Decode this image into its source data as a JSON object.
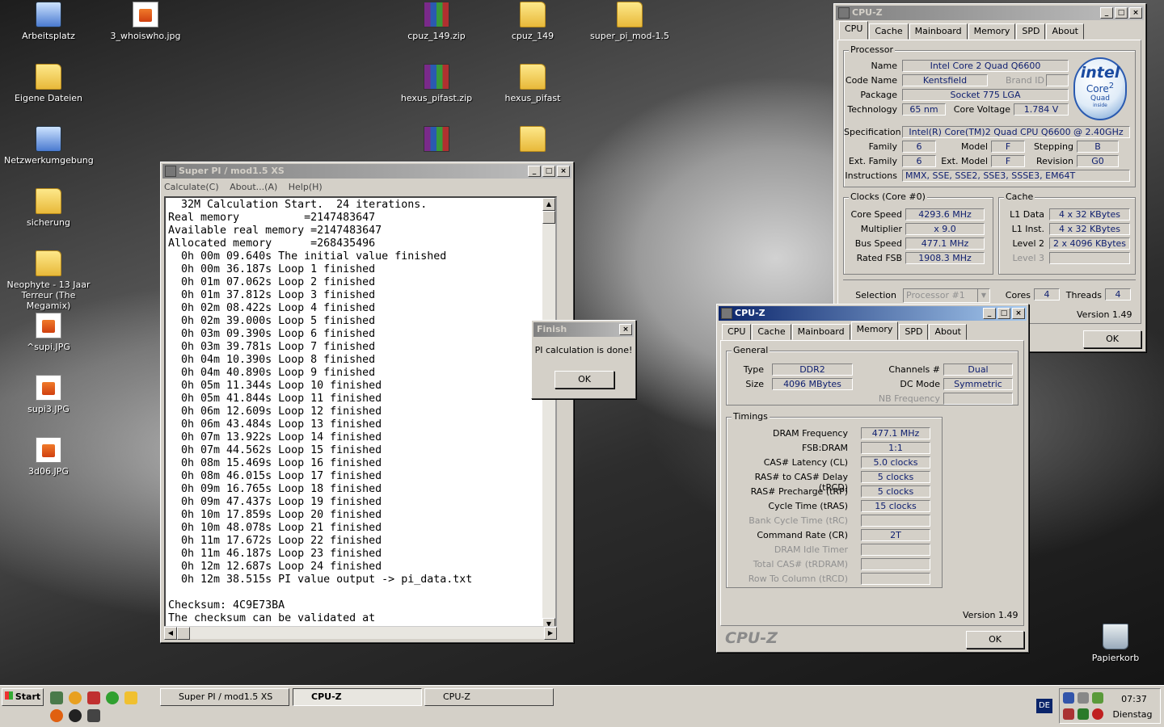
{
  "desktop": {
    "icons": [
      {
        "label": "Arbeitsplatz",
        "kind": "pc"
      },
      {
        "label": "3_whoiswho.jpg",
        "kind": "img"
      },
      {
        "label": "cpuz_149.zip",
        "kind": "zip"
      },
      {
        "label": "cpuz_149",
        "kind": "folder"
      },
      {
        "label": "super_pi_mod-1.5",
        "kind": "folder"
      },
      {
        "label": "Eigene Dateien",
        "kind": "folder"
      },
      {
        "label": "hexus_pifast.zip",
        "kind": "zip"
      },
      {
        "label": "hexus_pifast",
        "kind": "folder"
      },
      {
        "label": "Netzwerkumgebung",
        "kind": "pc"
      },
      {
        "label": "sicherung",
        "kind": "folder"
      },
      {
        "label": "Neophyte - 13 Jaar Terreur (The Megamix)",
        "kind": "folder"
      },
      {
        "label": "^supi.JPG",
        "kind": "img"
      },
      {
        "label": "supi3.JPG",
        "kind": "img"
      },
      {
        "label": "3d06.JPG",
        "kind": "img"
      },
      {
        "label": "Papierkorb",
        "kind": "trash"
      }
    ]
  },
  "superpi": {
    "title": "Super PI / mod1.5 XS",
    "menu": [
      "Calculate(C)",
      "About...(A)",
      "Help(H)"
    ],
    "output": "  32M Calculation Start.  24 iterations.\nReal memory          =2147483647\nAvailable real memory =2147483647\nAllocated memory      =268435496\n  0h 00m 09.640s The initial value finished\n  0h 00m 36.187s Loop 1 finished\n  0h 01m 07.062s Loop 2 finished\n  0h 01m 37.812s Loop 3 finished\n  0h 02m 08.422s Loop 4 finished\n  0h 02m 39.000s Loop 5 finished\n  0h 03m 09.390s Loop 6 finished\n  0h 03m 39.781s Loop 7 finished\n  0h 04m 10.390s Loop 8 finished\n  0h 04m 40.890s Loop 9 finished\n  0h 05m 11.344s Loop 10 finished\n  0h 05m 41.844s Loop 11 finished\n  0h 06m 12.609s Loop 12 finished\n  0h 06m 43.484s Loop 13 finished\n  0h 07m 13.922s Loop 14 finished\n  0h 07m 44.562s Loop 15 finished\n  0h 08m 15.469s Loop 16 finished\n  0h 08m 46.015s Loop 17 finished\n  0h 09m 16.765s Loop 18 finished\n  0h 09m 47.437s Loop 19 finished\n  0h 10m 17.859s Loop 20 finished\n  0h 10m 48.078s Loop 21 finished\n  0h 11m 17.672s Loop 22 finished\n  0h 11m 46.187s Loop 23 finished\n  0h 12m 12.687s Loop 24 finished\n  0h 12m 38.515s PI value output -> pi_data.txt\n\nChecksum: 4C9E73BA\nThe checksum can be validated at"
  },
  "finish": {
    "title": "Finish",
    "message": "PI calculation is done!",
    "ok": "OK"
  },
  "cpuz1": {
    "title": "CPU-Z",
    "tabs": [
      "CPU",
      "Cache",
      "Mainboard",
      "Memory",
      "SPD",
      "About"
    ],
    "processor": {
      "group": "Processor",
      "name_l": "Name",
      "name": "Intel Core 2 Quad Q6600",
      "code_l": "Code Name",
      "code": "Kentsfield",
      "brand_l": "Brand ID",
      "package_l": "Package",
      "package": "Socket 775 LGA",
      "tech_l": "Technology",
      "tech": "65 nm",
      "volt_l": "Core Voltage",
      "volt": "1.784 V",
      "spec_l": "Specification",
      "spec": "Intel(R) Core(TM)2 Quad CPU    Q6600  @ 2.40GHz",
      "family_l": "Family",
      "family": "6",
      "model_l": "Model",
      "model": "F",
      "stepping_l": "Stepping",
      "stepping": "B",
      "extfam_l": "Ext. Family",
      "extfam": "6",
      "extmod_l": "Ext. Model",
      "extmod": "F",
      "rev_l": "Revision",
      "rev": "G0",
      "instr_l": "Instructions",
      "instr": "MMX, SSE, SSE2, SSE3, SSSE3, EM64T"
    },
    "logo": {
      "brand": "intel",
      "line1": "Core",
      "line2": "2",
      "line3": "Quad",
      "line4": "inside"
    },
    "clocks": {
      "group": "Clocks (Core #0)",
      "speed_l": "Core Speed",
      "speed": "4293.6 MHz",
      "mult_l": "Multiplier",
      "mult": "x 9.0",
      "bus_l": "Bus Speed",
      "bus": "477.1 MHz",
      "fsb_l": "Rated FSB",
      "fsb": "1908.3 MHz"
    },
    "cache": {
      "group": "Cache",
      "l1d_l": "L1 Data",
      "l1d": "4 x 32 KBytes",
      "l1i_l": "L1 Inst.",
      "l1i": "4 x 32 KBytes",
      "l2_l": "Level 2",
      "l2": "2 x 4096 KBytes",
      "l3_l": "Level 3"
    },
    "sel_l": "Selection",
    "sel": "Processor #1",
    "cores_l": "Cores",
    "cores": "4",
    "threads_l": "Threads",
    "threads": "4",
    "version": "Version 1.49",
    "ok": "OK"
  },
  "cpuz2": {
    "title": "CPU-Z",
    "tabs": [
      "CPU",
      "Cache",
      "Mainboard",
      "Memory",
      "SPD",
      "About"
    ],
    "general": {
      "group": "General",
      "type_l": "Type",
      "type": "DDR2",
      "size_l": "Size",
      "size": "4096 MBytes",
      "ch_l": "Channels #",
      "ch": "Dual",
      "dc_l": "DC Mode",
      "dc": "Symmetric",
      "nb_l": "NB Frequency"
    },
    "timings": {
      "group": "Timings",
      "rows": [
        {
          "label": "DRAM Frequency",
          "value": "477.1 MHz",
          "dim": false
        },
        {
          "label": "FSB:DRAM",
          "value": "1:1",
          "dim": false
        },
        {
          "label": "CAS# Latency (CL)",
          "value": "5.0 clocks",
          "dim": false
        },
        {
          "label": "RAS# to CAS# Delay (tRCD)",
          "value": "5 clocks",
          "dim": false
        },
        {
          "label": "RAS# Precharge (tRP)",
          "value": "5 clocks",
          "dim": false
        },
        {
          "label": "Cycle Time (tRAS)",
          "value": "15 clocks",
          "dim": false
        },
        {
          "label": "Bank Cycle Time (tRC)",
          "value": "",
          "dim": true
        },
        {
          "label": "Command Rate (CR)",
          "value": "2T",
          "dim": false
        },
        {
          "label": "DRAM Idle Timer",
          "value": "",
          "dim": true
        },
        {
          "label": "Total CAS# (tRDRAM)",
          "value": "",
          "dim": true
        },
        {
          "label": "Row To Column (tRCD)",
          "value": "",
          "dim": true
        }
      ]
    },
    "version": "Version 1.49",
    "brand": "CPU-Z",
    "ok": "OK"
  },
  "taskbar": {
    "start": "Start",
    "tasks": [
      "Super PI / mod1.5 XS",
      "CPU-Z",
      "CPU-Z"
    ],
    "lang": "DE",
    "time": "07:37",
    "day": "Dienstag"
  }
}
